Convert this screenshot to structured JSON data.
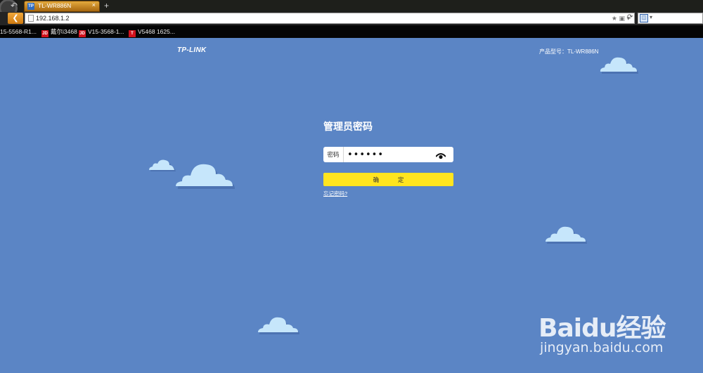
{
  "browser": {
    "tab": {
      "favicon": "TP",
      "title": "TL-WR886N",
      "close": "×"
    },
    "new_tab": "+",
    "url": "192.168.1.2",
    "bookmarks": [
      {
        "label": "15-5568-R1...",
        "icon": ""
      },
      {
        "label": "戴尔i3468",
        "icon": "JD"
      },
      {
        "label": "V15-3568-1...",
        "icon": "JD"
      },
      {
        "label": "V5468 1625...",
        "icon": "T"
      }
    ]
  },
  "page": {
    "brand": "TP-LINK",
    "model": "产品型号：TL-WR886N",
    "login": {
      "title": "管理员密码",
      "password_label": "密码",
      "password_value": "••••••",
      "confirm_button": "确 定",
      "forgot_link": "忘记密码?"
    }
  },
  "watermark": {
    "logo": "Baidu经验",
    "domain": "jingyan.baidu.com"
  },
  "colors": {
    "background": "#5b85c5",
    "button": "#ffe51f",
    "cloud": "#c6e6fb",
    "tab_accent": "#e4aa3e"
  }
}
